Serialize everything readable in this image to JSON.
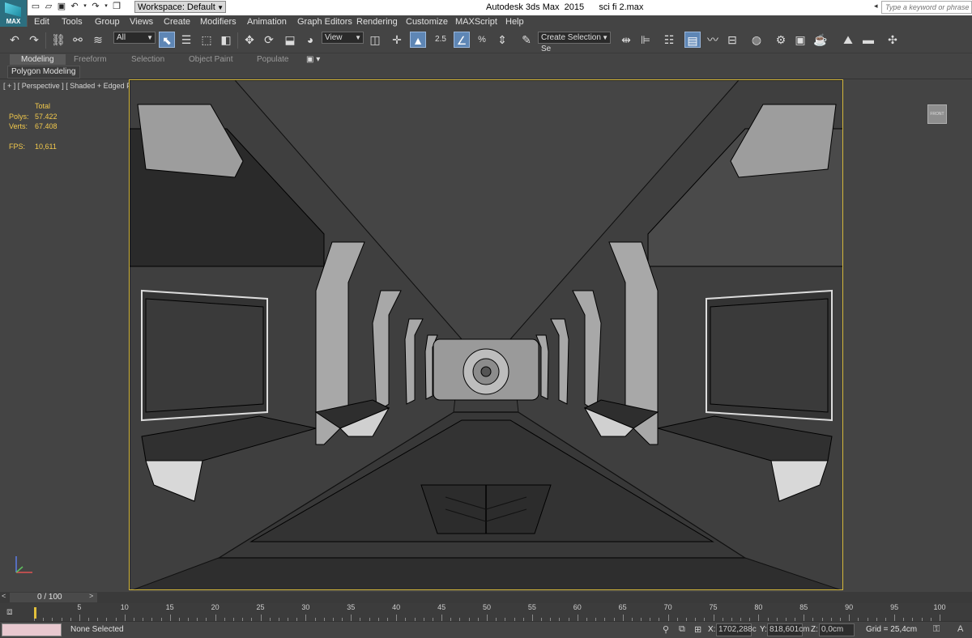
{
  "app": {
    "logo_text": "MAX",
    "window_title": "Autodesk 3ds Max  2015      sci fi 2.max",
    "workspace": "Workspace: Default",
    "help_search_placeholder": "Type a keyword or phrase"
  },
  "menu": [
    "Edit",
    "Tools",
    "Group",
    "Views",
    "Create",
    "Modifiers",
    "Animation",
    "Graph Editors",
    "Rendering",
    "Customize",
    "MAXScript",
    "Help"
  ],
  "toolbar": {
    "selection_filter": "All",
    "ref_coord": "View",
    "snap_label": "2.5",
    "named_selection_placeholder": "Create Selection Se"
  },
  "ribbon": {
    "tabs": [
      "Modeling",
      "Freeform",
      "Selection",
      "Object Paint",
      "Populate"
    ],
    "selected_tab": "Modeling",
    "panel_title": "Polygon Modeling"
  },
  "viewport": {
    "label": "[ + ] [ Perspective ] [ Shaded + Edged Faces ]",
    "stats": {
      "header": "Total",
      "polys_label": "Polys:",
      "polys_value": "57.422",
      "verts_label": "Verts:",
      "verts_value": "67.408",
      "fps_label": "FPS:",
      "fps_value": "10,611"
    },
    "viewcube_label": "FRONT",
    "safe_frame_color": "#d4b73a"
  },
  "time": {
    "frame_counter": "0 / 100",
    "ticks": [
      "0",
      "5",
      "10",
      "15",
      "20",
      "25",
      "30",
      "35",
      "40",
      "45",
      "50",
      "55",
      "60",
      "65",
      "70",
      "75",
      "80",
      "85",
      "90",
      "95",
      "100"
    ]
  },
  "status": {
    "message": "None Selected",
    "x_label": "X:",
    "x_value": "1702,288c",
    "y_label": "Y:",
    "y_value": "818,601cm",
    "z_label": "Z:",
    "z_value": "0,0cm",
    "grid": "Grid = 25,4cm"
  },
  "colors": {
    "accent_blue": "#5e86b5",
    "stats_yellow": "#f2c94c",
    "ui_dark": "#444444"
  }
}
